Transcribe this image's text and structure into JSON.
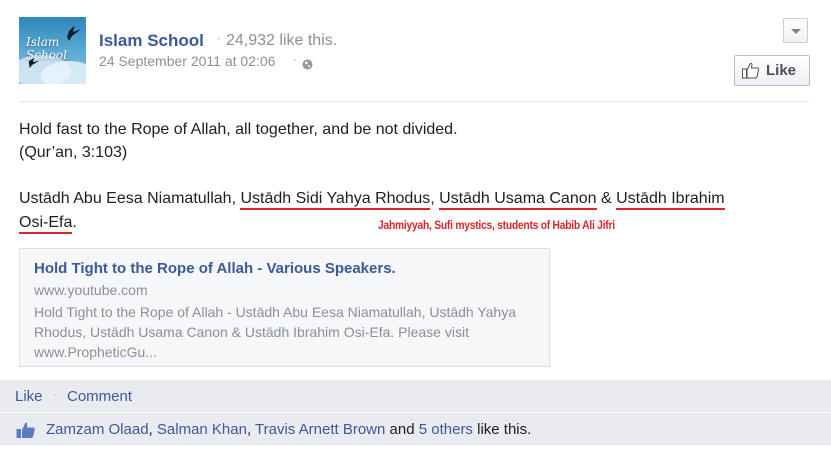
{
  "post": {
    "page_name": "Islam School",
    "dot": "·",
    "like_count": "24,932 like this.",
    "timestamp": "24 September 2011 at 02:06",
    "avatar_text_line1": "Islam",
    "avatar_text_line2": "School",
    "avatar_icon": "bird-icon",
    "menu_icon": "chevron-down-icon",
    "privacy_icon": "globe-icon",
    "like_button_label": "Like",
    "like_button_icon": "thumbs-up-icon"
  },
  "body": {
    "line1": "Hold fast to the Rope of Allah, all together, and be not divided.",
    "line2": "(Qur’an, 3:103)",
    "speaker1": "Ustādh Abu Eesa Niamatullah, ",
    "speaker2": "Ustādh Sidi Yahya Rhodus",
    "comma1": ", ",
    "speaker3": "Ustādh Usama Canon",
    "amp": " & ",
    "speaker4a": "Ustādh Ibrahim",
    "speaker4b": "Osi-Efa",
    "period": ".",
    "annotation": "Jahmiyyah, Sufi mystics, students of Habib Ali Jifri"
  },
  "link_card": {
    "title": "Hold Tight to the Rope of Allah - Various Speakers.",
    "domain": "www.youtube.com",
    "description": "Hold Tight to the Rope of Allah - Ustādh Abu Eesa Niamatullah, Ustādh Yahya Rhodus, Ustādh Usama Canon & Ustādh Ibrahim Osi-Efa. Please visit www.PropheticGu..."
  },
  "actions": {
    "like": "Like",
    "dot": "·",
    "comment": "Comment"
  },
  "likers": {
    "name1": "Zamzam Olaad",
    "sep1": ", ",
    "name2": "Salman Khan",
    "sep2": ", ",
    "name3": "Travis Arnett Brown",
    "and": " and ",
    "others": "5 others",
    "suffix": " like this.",
    "icon": "thumbs-up-icon"
  },
  "colors": {
    "link_blue": "#3b5998",
    "annotation_red": "#d9262c",
    "muted_gray": "#8a8f98",
    "bar_background": "#e9ebf1"
  }
}
